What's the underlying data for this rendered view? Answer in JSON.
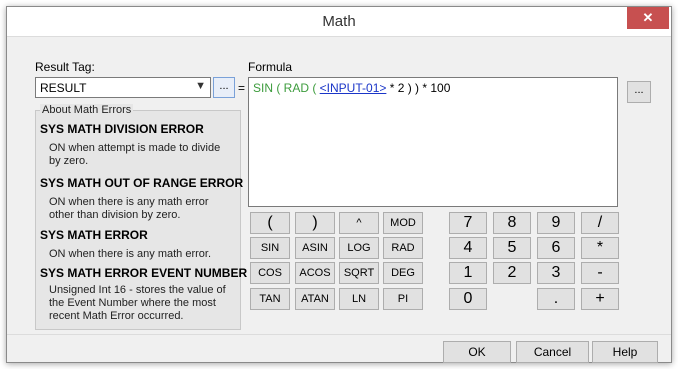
{
  "window": {
    "title": "Math",
    "close_glyph": "✕"
  },
  "result": {
    "label": "Result Tag:",
    "value": "RESULT",
    "browse_label": "...",
    "equals": "="
  },
  "formula": {
    "label": "Formula",
    "browse_label": "...",
    "tokens": [
      {
        "text": "SIN ( RAD ( ",
        "style": "green"
      },
      {
        "text": "<INPUT-01>",
        "style": "link"
      },
      {
        "text": " * 2 ) ) * 100",
        "style": "black"
      }
    ]
  },
  "math_errors": {
    "legend": "About Math Errors",
    "items": [
      {
        "title": "SYS MATH DIVISION ERROR",
        "desc": [
          "ON when attempt is made to divide",
          "by zero."
        ]
      },
      {
        "title": "SYS MATH OUT OF RANGE ERROR",
        "desc": [
          "ON when there is any math error",
          "other than division by zero."
        ]
      },
      {
        "title": "SYS MATH ERROR",
        "desc": [
          "ON when there is any math error."
        ]
      },
      {
        "title": "SYS MATH ERROR EVENT NUMBER",
        "desc": [
          "Unsigned Int 16 - stores the value of",
          "the Event Number where the most",
          "recent Math Error occurred."
        ]
      }
    ]
  },
  "keypad": {
    "functions": [
      "(",
      ")",
      "^",
      "MOD",
      "SIN",
      "ASIN",
      "LOG",
      "RAD",
      "COS",
      "ACOS",
      "SQRT",
      "DEG",
      "TAN",
      "ATAN",
      "LN",
      "PI"
    ],
    "digits": [
      "7",
      "8",
      "9",
      "/",
      "4",
      "5",
      "6",
      "*",
      "1",
      "2",
      "3",
      "-",
      "0",
      ".",
      "+"
    ]
  },
  "footer": {
    "ok": "OK",
    "cancel": "Cancel",
    "help": "Help"
  }
}
